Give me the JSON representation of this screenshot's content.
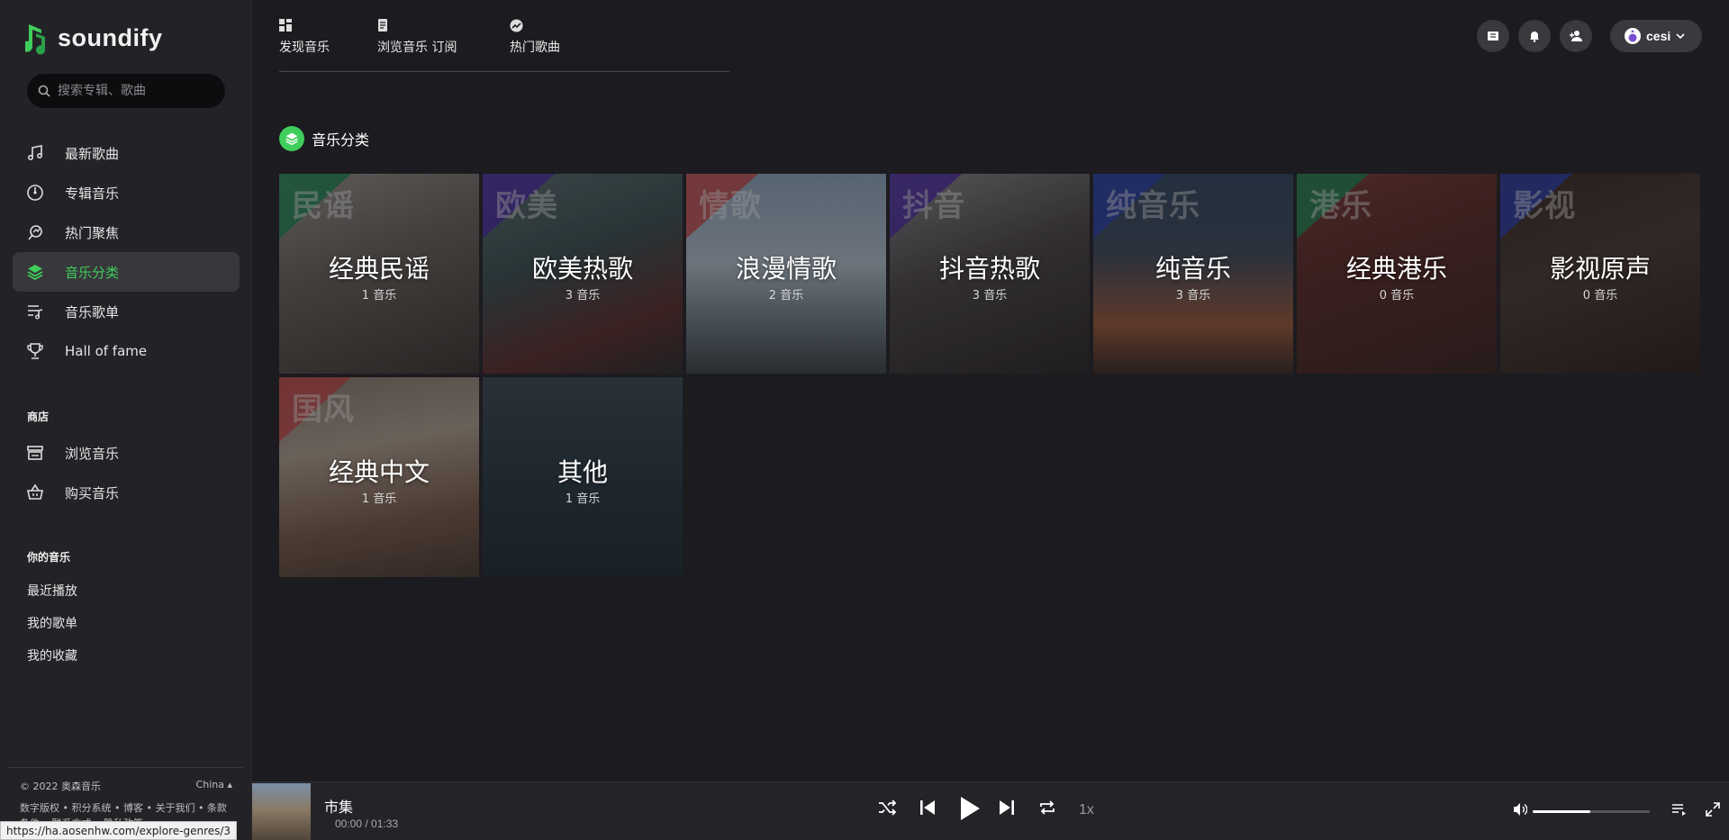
{
  "app": {
    "name": "soundify"
  },
  "search": {
    "placeholder": "搜索专辑、歌曲"
  },
  "sidebar": {
    "nav": [
      {
        "label": "最新歌曲",
        "icon": "music-note-icon",
        "active": false
      },
      {
        "label": "专辑音乐",
        "icon": "disc-icon",
        "active": false
      },
      {
        "label": "热门聚焦",
        "icon": "trend-icon",
        "active": false
      },
      {
        "label": "音乐分类",
        "icon": "layers-icon",
        "active": true
      },
      {
        "label": "音乐歌单",
        "icon": "playlist-icon",
        "active": false
      },
      {
        "label": "Hall of fame",
        "icon": "trophy-icon",
        "active": false
      }
    ],
    "shop_title": "商店",
    "shop": [
      {
        "label": "浏览音乐",
        "icon": "store-icon"
      },
      {
        "label": "购买音乐",
        "icon": "basket-icon"
      }
    ],
    "your_title": "你的音乐",
    "your_music": [
      "最近播放",
      "我的歌单",
      "我的收藏"
    ],
    "footer": {
      "copyright": "© 2022 奥森音乐",
      "region": "China ▴",
      "links": "数字版权 • 积分系统 • 博客 • 关于我们 • 条款条件 • 联系方式 • 隐私政策"
    },
    "url_hint": "https://ha.aosenhw.com/explore-genres/3"
  },
  "tabs": [
    {
      "label": "发现音乐",
      "icon": "grid-icon"
    },
    {
      "label": "浏览音乐  订阅",
      "icon": "document-icon"
    },
    {
      "label": "热门歌曲",
      "icon": "trending-icon"
    }
  ],
  "header": {
    "user": "cesi"
  },
  "section": {
    "title": "音乐分类"
  },
  "genres": [
    {
      "tag": "民谣",
      "title": "经典民谣",
      "count": "1 音乐",
      "accent": "#1f8a55",
      "bg": "linear-gradient(160deg,#9a9591 0%,#6b6560 40%,#3a3430 100%)"
    },
    {
      "tag": "欧美",
      "title": "欧美热歌",
      "count": "3 音乐",
      "accent": "#4b2aa8",
      "bg": "linear-gradient(160deg,#5d6f74 0%,#3a4f52 40%,#5b2d2d 75%,#2a2a2a 100%)"
    },
    {
      "tag": "情歌",
      "title": "浪漫情歌",
      "count": "2 音乐",
      "accent": "#c94848",
      "bg": "linear-gradient(180deg,#8fa6bf 0%,#b4c2cf 45%,#6d7b86 75%,#3c4247 100%)"
    },
    {
      "tag": "抖音",
      "title": "抖音热歌",
      "count": "3 音乐",
      "accent": "#4e2aa8",
      "bg": "linear-gradient(160deg,#8a8a8c 0%,#4b4547 45%,#2a2527 100%)"
    },
    {
      "tag": "纯音乐",
      "title": "纯音乐",
      "count": "3 音乐",
      "accent": "#2a3fb2",
      "bg": "linear-gradient(180deg,#2f4660 0%,#3f4a5e 40%,#9a5a3a 75%,#3a2a25 100%)"
    },
    {
      "tag": "港乐",
      "title": "经典港乐",
      "count": "0 音乐",
      "accent": "#1f8a55",
      "bg": "linear-gradient(160deg,#7a3a35 0%,#5a2a25 40%,#3a2320 100%)"
    },
    {
      "tag": "影视",
      "title": "影视原声",
      "count": "0 音乐",
      "accent": "#2a3fb2",
      "bg": "linear-gradient(160deg,#3a2a25 0%,#4a3a33 45%,#2a1e1a 100%)"
    },
    {
      "tag": "国风",
      "title": "经典中文",
      "count": "1 音乐",
      "accent": "#c94848",
      "bg": "linear-gradient(170deg,#8a7a70 0%,#b0a090 35%,#7a5a4a 70%,#4a3a30 100%)"
    },
    {
      "tag": "",
      "title": "其他",
      "count": "1 音乐",
      "accent": "transparent",
      "bg": "linear-gradient(180deg,#3a4a55 0%,#2a3a45 45%,#1e2a33 100%)"
    }
  ],
  "player": {
    "title": "市集",
    "time": "00:00 / 01:33",
    "speed": "1x",
    "volume": 0.49
  },
  "colors": {
    "accent": "#3fce5b",
    "bg": "#1c1b1f",
    "sidebar": "#232226"
  }
}
